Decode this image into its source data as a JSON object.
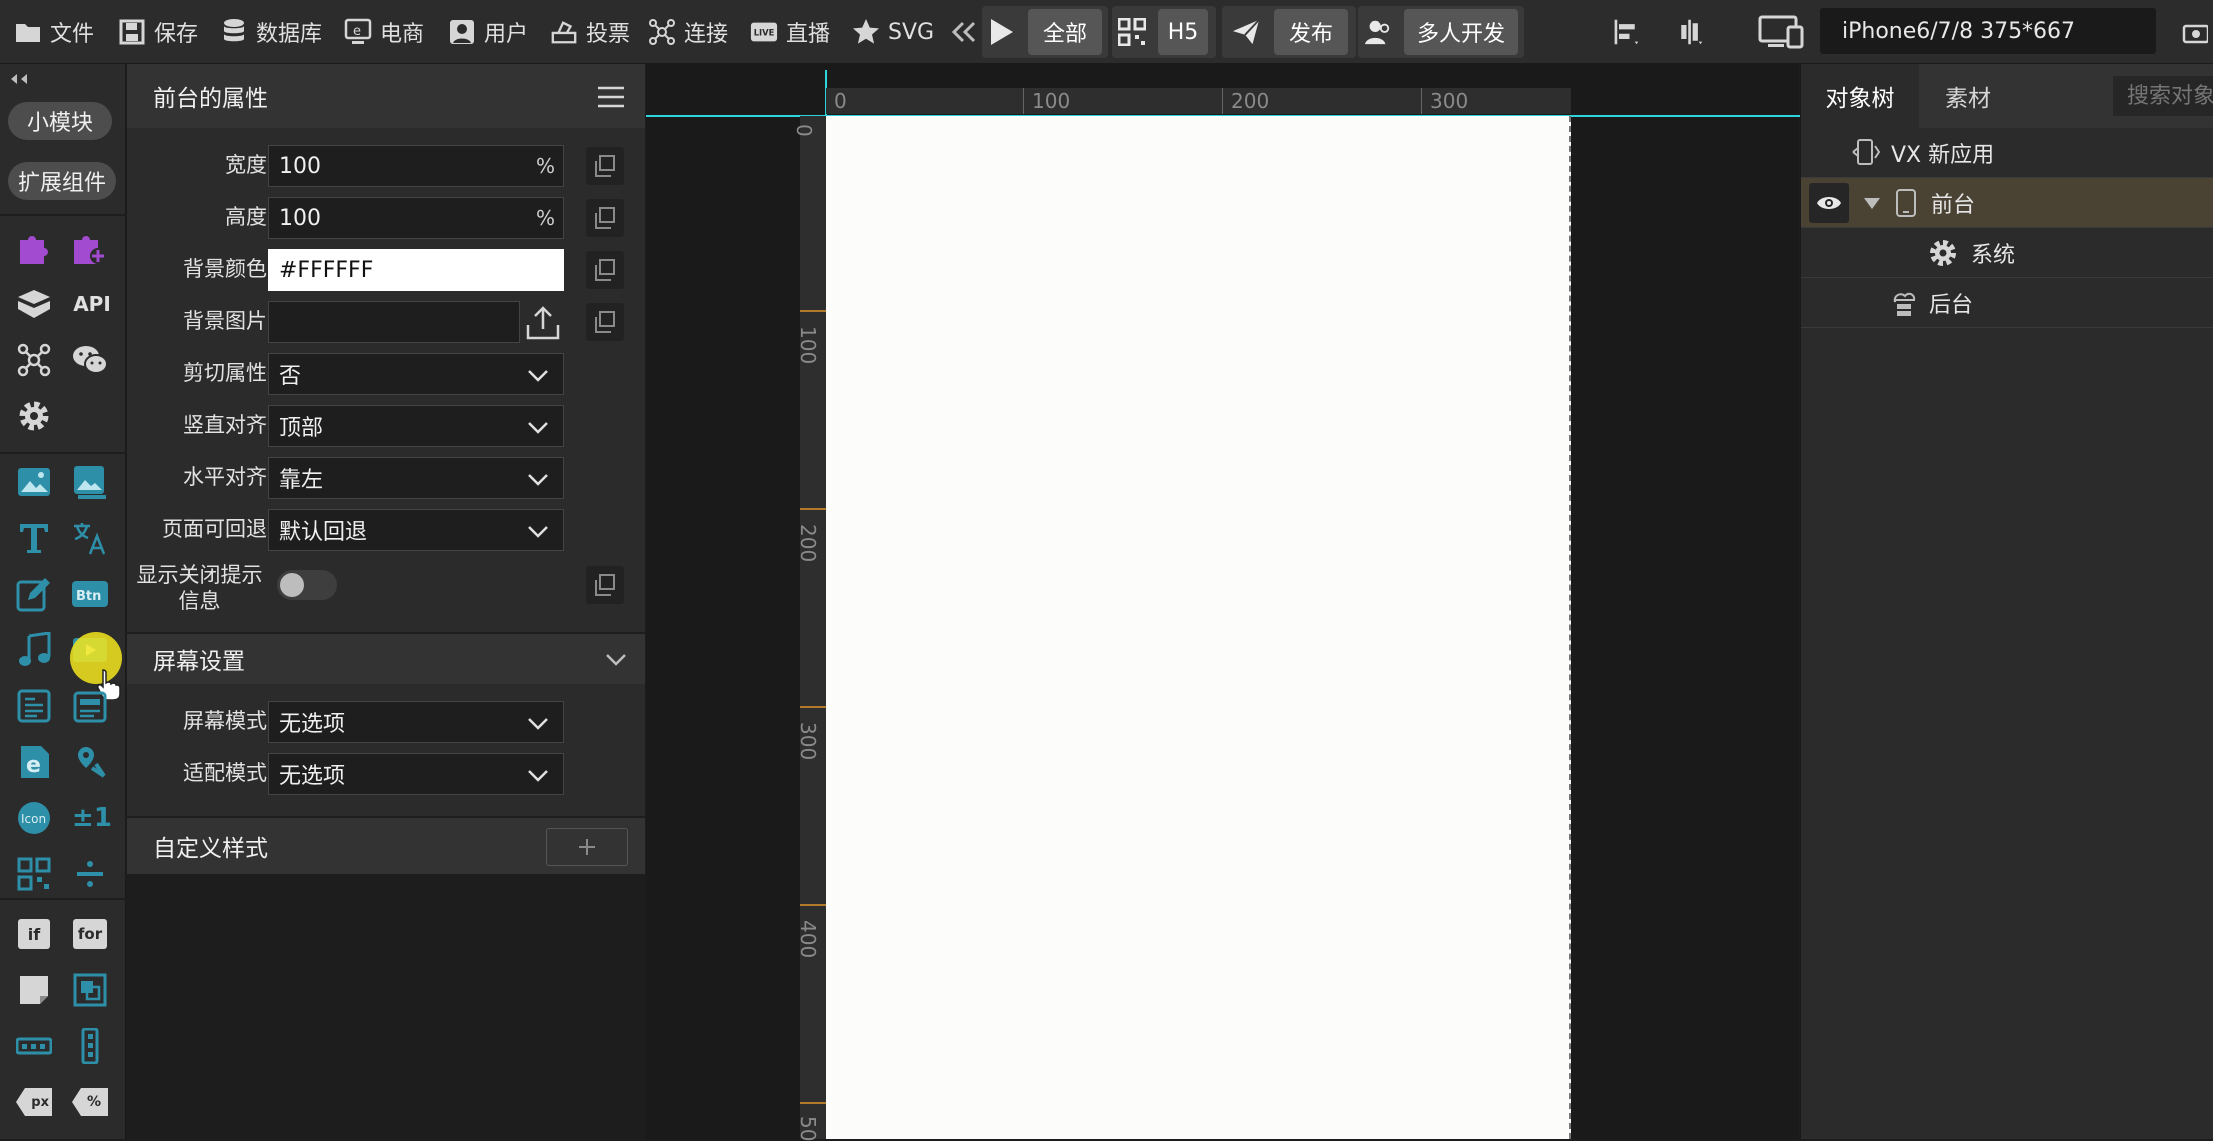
{
  "toolbar": {
    "file": "文件",
    "save": "保存",
    "database": "数据库",
    "ecommerce": "电商",
    "user": "用户",
    "vote": "投票",
    "connect": "连接",
    "live": "直播",
    "svg": "SVG",
    "all": "全部",
    "h5": "H5",
    "publish": "发布",
    "multi_dev": "多人开发",
    "device": "iPhone6/7/8 375*667"
  },
  "rail": {
    "small_module": "小模块",
    "extensions": "扩展组件",
    "api": "API",
    "btn": "Btn",
    "icon": "Icon",
    "plus_minus": "±1",
    "if": "if",
    "for": "for",
    "px": "px",
    "percent": "%"
  },
  "props": {
    "title": "前台的属性",
    "fields": [
      {
        "label": "宽度",
        "value": "100",
        "unit": "%"
      },
      {
        "label": "高度",
        "value": "100",
        "unit": "%"
      },
      {
        "label": "背景颜色",
        "value": "#FFFFFF"
      },
      {
        "label": "背景图片",
        "value": ""
      },
      {
        "label": "剪切属性",
        "value": "否"
      },
      {
        "label": "竖直对齐",
        "value": "顶部"
      },
      {
        "label": "水平对齐",
        "value": "靠左"
      },
      {
        "label": "页面可回退",
        "value": "默认回退"
      }
    ],
    "close_tip_label": "显示关闭提示信息",
    "screen_section": "屏幕设置",
    "screen_mode_label": "屏幕模式",
    "screen_mode_value": "无选项",
    "fit_mode_label": "适配模式",
    "fit_mode_value": "无选项",
    "custom_style": "自定义样式"
  },
  "rulers": {
    "top": [
      "0",
      "100",
      "200",
      "300"
    ],
    "left": [
      "0",
      "100",
      "200",
      "300",
      "400",
      "50"
    ]
  },
  "tree": {
    "tab_tree": "对象树",
    "tab_assets": "素材",
    "search_placeholder": "搜索对象",
    "nodes": [
      {
        "label": "VX 新应用"
      },
      {
        "label": "前台"
      },
      {
        "label": "系统"
      },
      {
        "label": "后台"
      }
    ]
  },
  "colors": {
    "accent_cyan": "#2fd3dc",
    "purple": "#a24bd1",
    "teal": "#2e8fa8",
    "selected_row": "#4a4233"
  }
}
